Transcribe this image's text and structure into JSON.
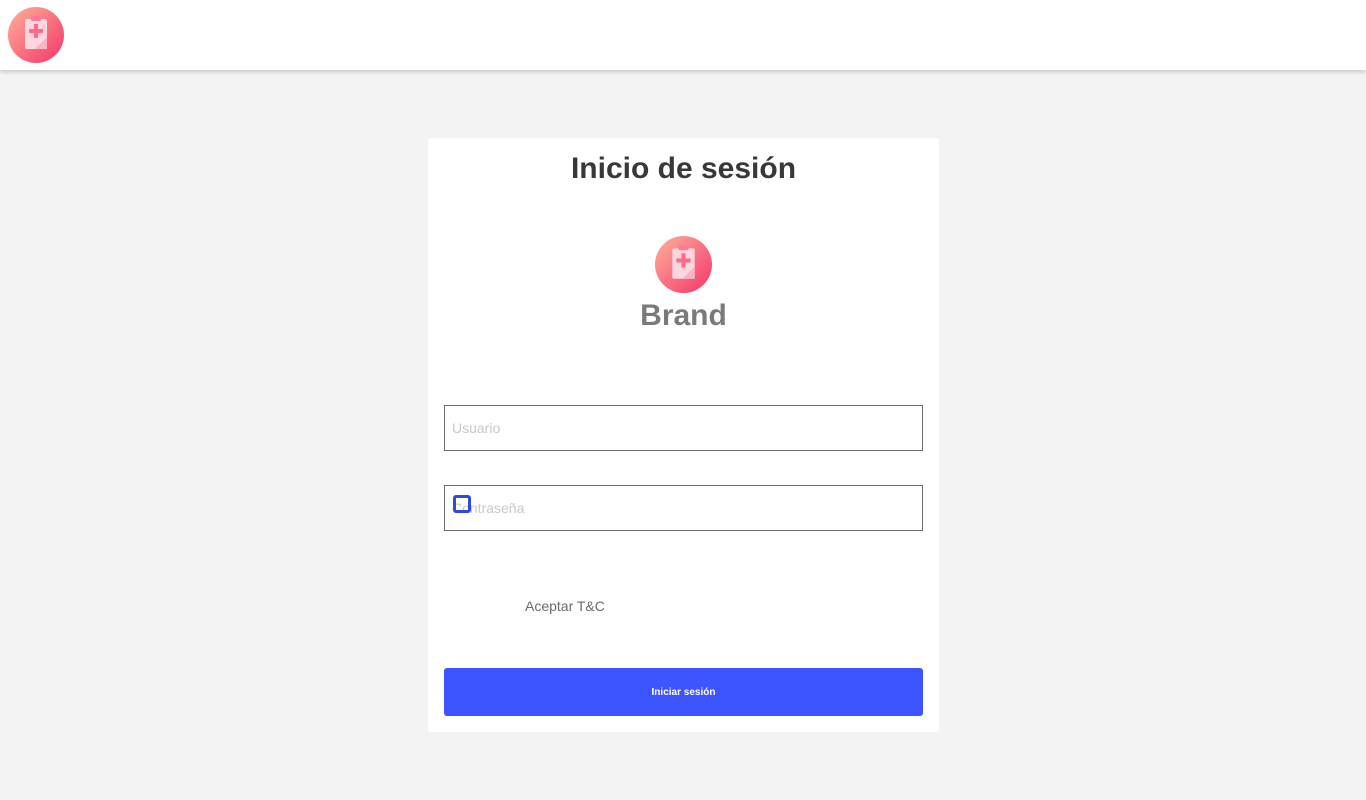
{
  "header": {
    "logo_icon": "clipboard-medical-icon"
  },
  "login": {
    "title": "Inicio de sesión",
    "brand_icon": "clipboard-medical-icon",
    "brand_name": "Brand",
    "username_placeholder": "Usuario",
    "password_placeholder": "Contraseña",
    "terms_label": "Aceptar T&C",
    "terms_checked": false,
    "submit_label": "Iniciar sesión"
  },
  "colors": {
    "background": "#f3f3f3",
    "accent": "#3d55ff",
    "logo_gradient_start": "#ffb199",
    "logo_gradient_end": "#f3356b"
  }
}
